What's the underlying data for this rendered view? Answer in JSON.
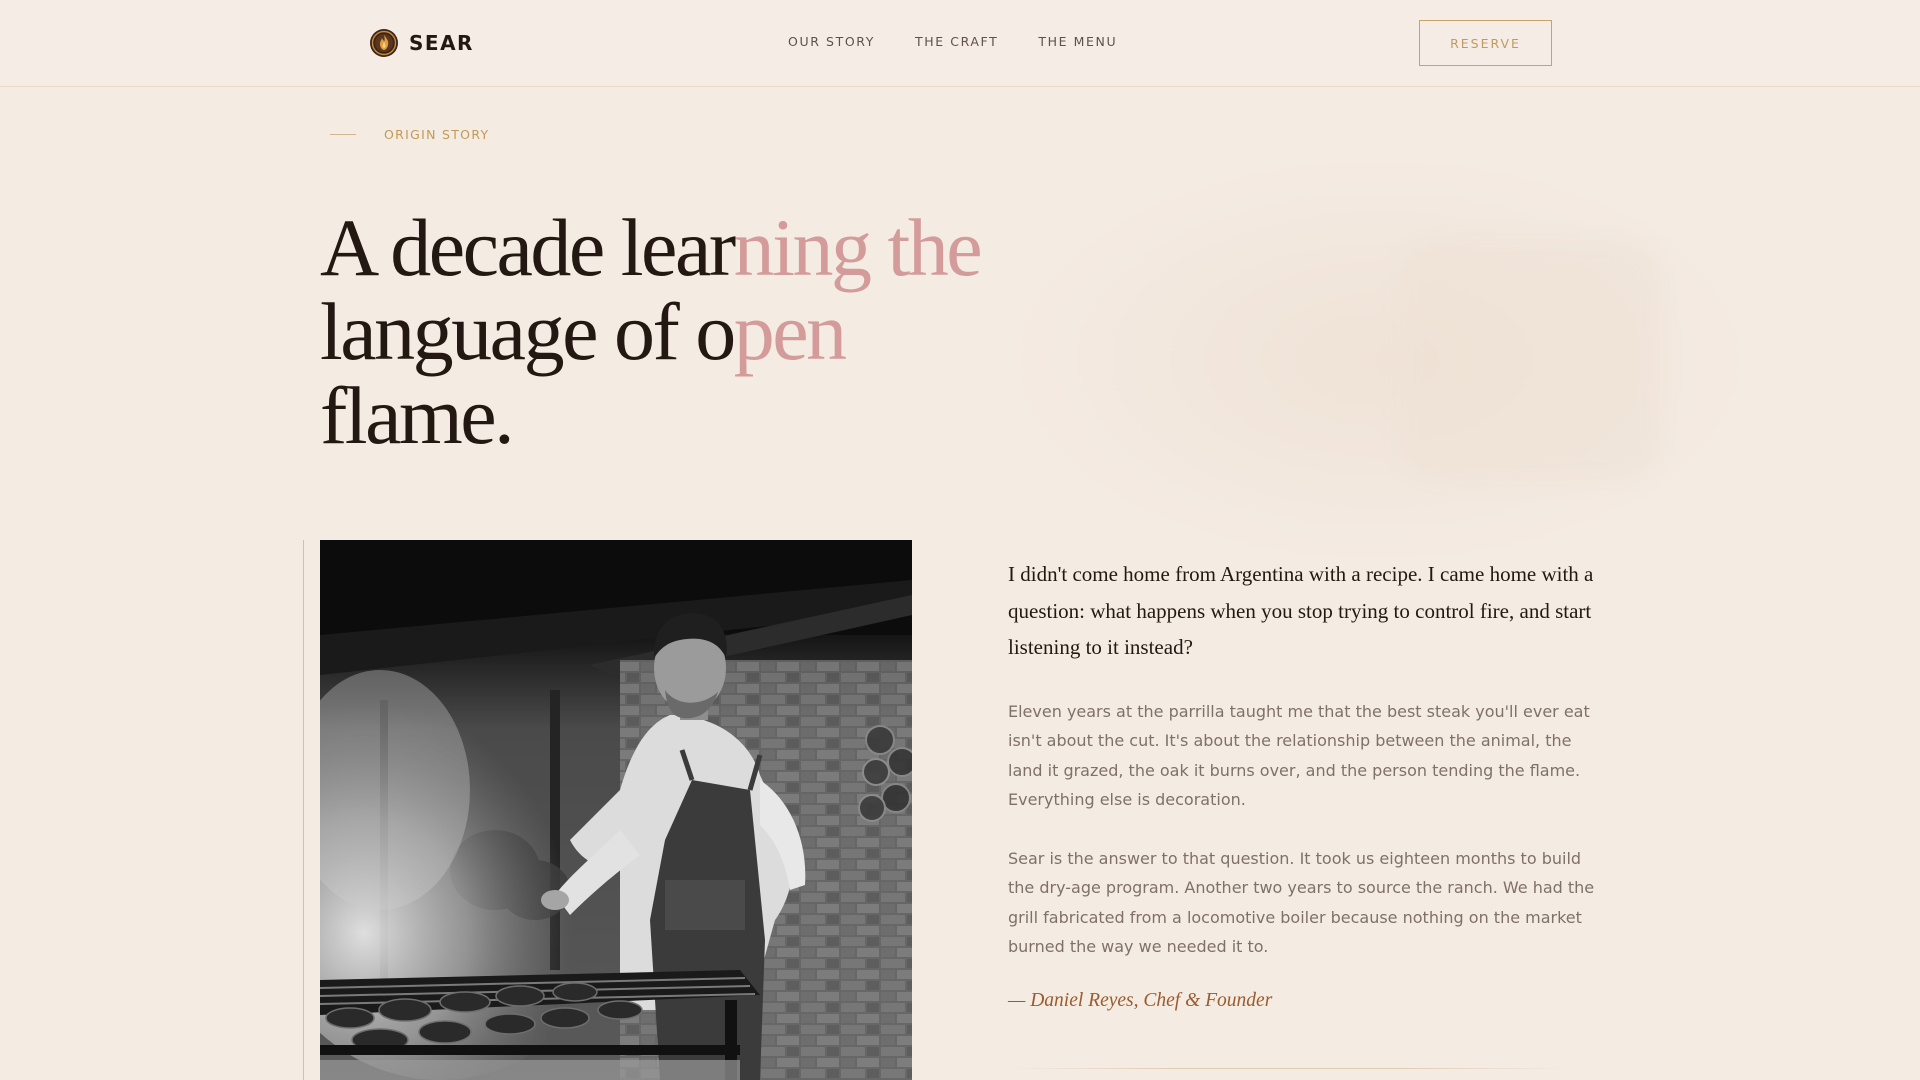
{
  "brand": {
    "name": "SEAR",
    "logo_icon": "flame-emblem-icon"
  },
  "nav": {
    "items": [
      {
        "label": "OUR STORY"
      },
      {
        "label": "THE CRAFT"
      },
      {
        "label": "THE MENU"
      }
    ],
    "cta_label": "RESERVE"
  },
  "hero": {
    "eyebrow": "ORIGIN STORY",
    "headline": {
      "line1_dark": "A decade lear",
      "line1_light": "ning the",
      "line2_dark": "language of o",
      "line2_light": "pen",
      "line3_dark": "flame."
    }
  },
  "photo": {
    "subject": "chef-grilling-photo",
    "style": "black-and-white"
  },
  "story": {
    "lead": "I didn't come home from Argentina with a recipe. I came home with a question: what happens when you stop trying to control fire, and start listening to it instead?",
    "paragraphs": [
      "Eleven years at the parrilla taught me that the best steak you'll ever eat isn't about the cut. It's about the relationship between the animal, the land it grazed, the oak it burns over, and the person tending the flame. Everything else is decoration.",
      "Sear is the answer to that question. It took us eighteen months to build the dry-age program. Another two years to source the ranch. We had the grill fabricated from a locomotive boiler because nothing on the market burned the way we needed it to."
    ],
    "signature": "— Daniel Reyes, Chef & Founder"
  },
  "colors": {
    "background": "#f4ebe3",
    "text_dark": "#241812",
    "headline_light": "#d49b9b",
    "accent_gold": "#c29a56",
    "signature_brown": "#9a5b2e",
    "body_muted": "#7f716a"
  }
}
